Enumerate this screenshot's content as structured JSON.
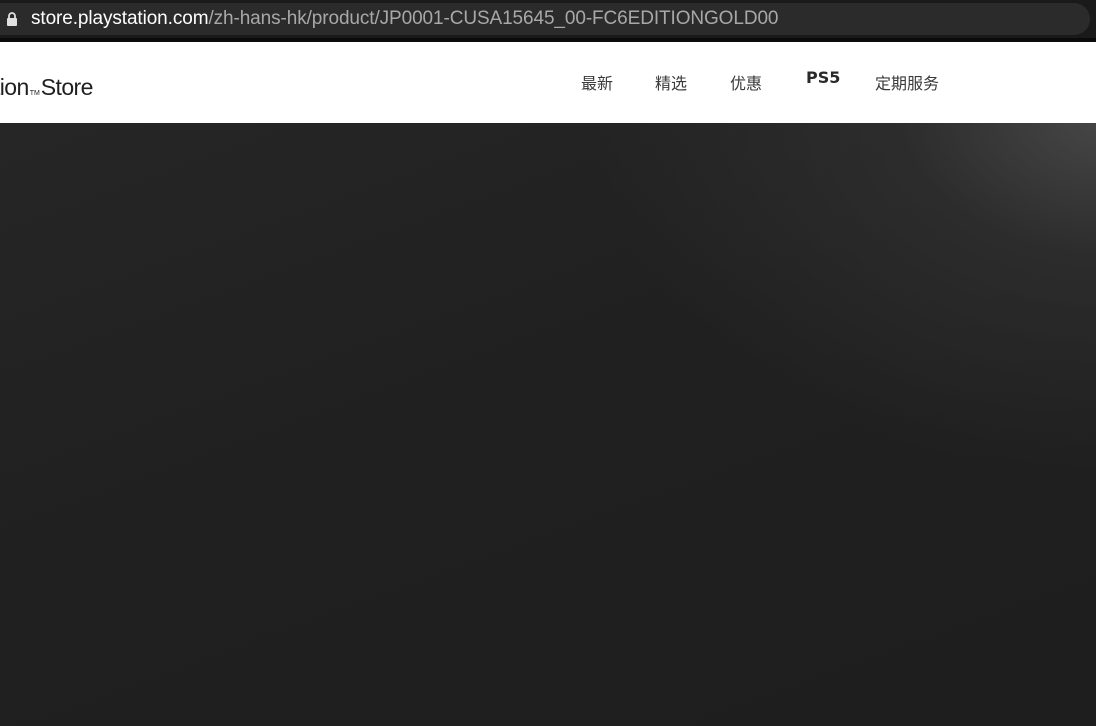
{
  "browser": {
    "url_host": "store.playstation.com",
    "url_path": "/zh-hans-hk/product/JP0001-CUSA15645_00-FC6EDITIONGOLD00",
    "lock_icon": "lock-icon"
  },
  "header": {
    "brand_prefix": "tion",
    "brand_tm": "TM",
    "brand_suffix": "Store",
    "nav": [
      {
        "label": "最新"
      },
      {
        "label": "精选"
      },
      {
        "label": "优惠"
      },
      {
        "label": "PS5"
      },
      {
        "label": "定期服务"
      }
    ]
  },
  "colors": {
    "header_bg": "#ffffff",
    "hero_bg": "#1f1f1f",
    "address_bar_bg": "#2b2b2b"
  }
}
